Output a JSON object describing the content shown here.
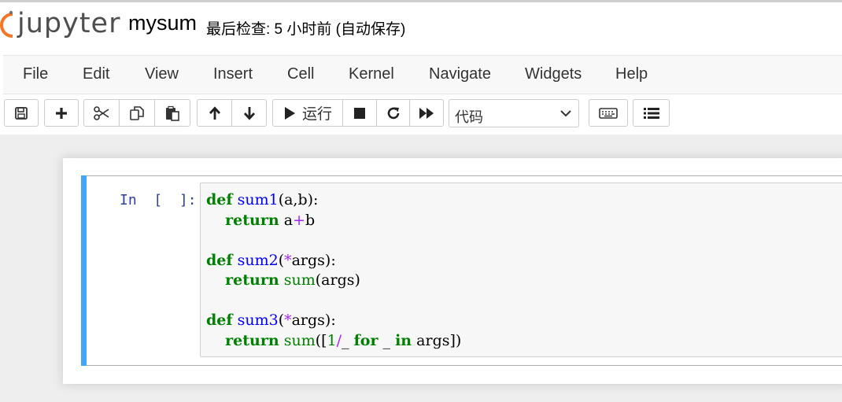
{
  "header": {
    "logo_text": "jupyter",
    "notebook_name": "mysum",
    "checkpoint_status": "最后检查: 5 小时前  (自动保存)"
  },
  "menubar": {
    "items": [
      "File",
      "Edit",
      "View",
      "Insert",
      "Cell",
      "Kernel",
      "Navigate",
      "Widgets",
      "Help"
    ]
  },
  "toolbar": {
    "run_label": "运行",
    "cell_type": "代码",
    "icons": [
      "save-icon",
      "plus-icon",
      "cut-icon",
      "copy-icon",
      "paste-icon",
      "arrow-up-icon",
      "arrow-down-icon",
      "play-icon",
      "stop-icon",
      "restart-icon",
      "fast-forward-icon",
      "chevron-down-icon",
      "keyboard-icon",
      "list-icon"
    ]
  },
  "cell": {
    "prompt": "In  [  ]:",
    "code": {
      "l1_kw": "def",
      "l1_fn": "sum1",
      "l1_rest": "(a,b):",
      "l2_kw": "return",
      "l2_a": "a",
      "l2_op": "+",
      "l2_b": "b",
      "l3_kw": "def",
      "l3_fn": "sum2",
      "l3_p1": "(",
      "l3_op": "*",
      "l3_rest": "args):",
      "l4_kw": "return",
      "l4_bi": "sum",
      "l4_rest": "(args)",
      "l5_kw": "def",
      "l5_fn": "sum3",
      "l5_p1": "(",
      "l5_op": "*",
      "l5_rest": "args):",
      "l6_kw": "return",
      "l6_bi": "sum",
      "l6_p1": "([",
      "l6_num": "1",
      "l6_op": "/",
      "l6_u": "_ ",
      "l6_for": "for",
      "l6_u2": " _ ",
      "l6_in": "in",
      "l6_rest": " args])"
    }
  },
  "colors": {
    "accent_cell_bar": "#42a5f5",
    "logo_orange": "#f37726",
    "keyword_green": "#008000",
    "function_blue": "#0000ff",
    "operator_purple": "#aa22ff",
    "prompt_blue": "#303f9f"
  }
}
